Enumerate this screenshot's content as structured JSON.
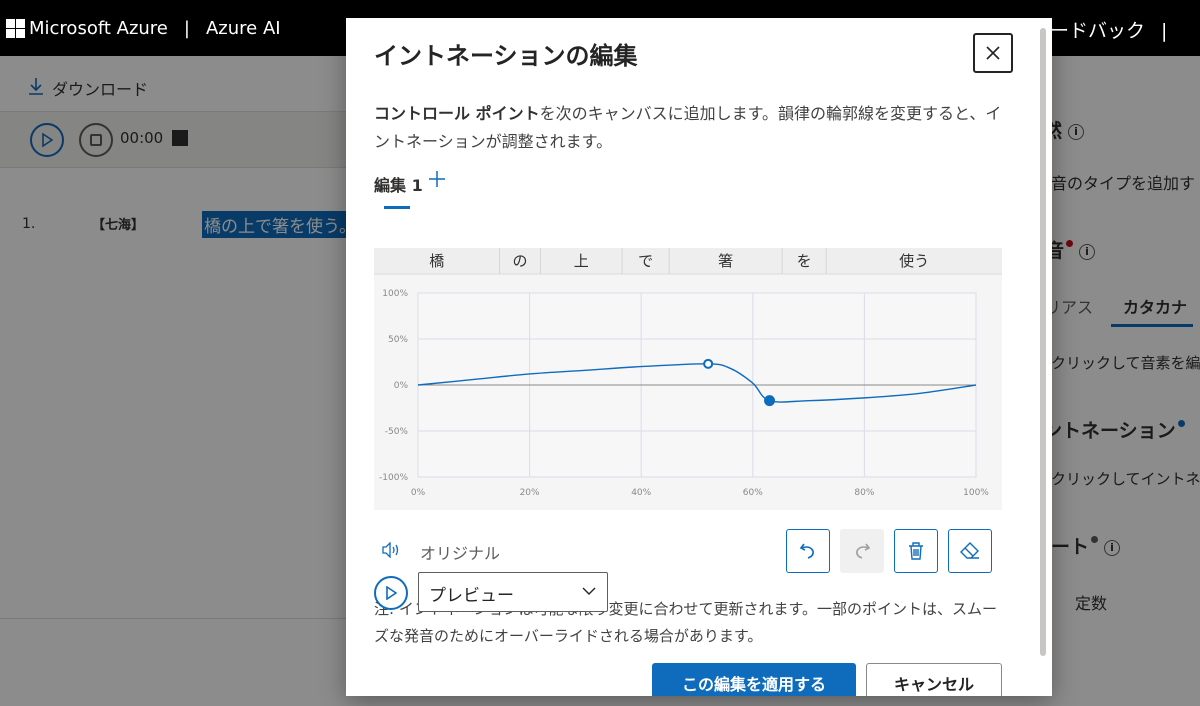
{
  "topbar": {
    "brand": "Microsoft Azure",
    "separator": "|",
    "product": "Azure AI",
    "right_text": "ードバック",
    "right_sep": "|"
  },
  "background": {
    "download_label": "ダウンロード",
    "timecode": "00:00",
    "line_number": "1.",
    "voice_name": "【七海】",
    "sentence": "橋の上で箸を使う。",
    "right_panel": {
      "heading1": "然",
      "text1": "音のタイプを追加す",
      "heading2": "音",
      "tab_alias": "リアス",
      "tab_katakana": "カタカナ",
      "text2": "クリックして音素を編",
      "heading3": "ントネーション",
      "text3": "クリックしてイントネ",
      "heading4": "ート",
      "value4": "定数"
    },
    "colors": {
      "accent": "#0f6cbd",
      "dot_red": "#c50f1f",
      "dot_blue": "#0f6cbd",
      "dot_gray": "#605e5c"
    }
  },
  "dialog": {
    "title": "イントネーションの編集",
    "description_bold": "コントロール ポイント",
    "description_rest": "を次のキャンバスに追加します。韻律の輪郭線を変更すると、イントネーションが調整されます。",
    "tab_label": "編集 1",
    "original_label": "オリジナル",
    "preview_selected": "プレビュー",
    "note": "注: イントネーションは可能な限り変更に合わせて更新されます。一部のポイントは、スムーズな発音のためにオーバーライドされる場合があります。",
    "apply_button": "この編集を適用する",
    "cancel_button": "キャンセル",
    "icons": {
      "close": "close-icon",
      "add": "plus-icon",
      "speaker": "speaker-icon",
      "undo": "undo-icon",
      "redo": "redo-icon",
      "delete": "trash-icon",
      "erase": "eraser-icon",
      "play": "play-icon",
      "chevron": "chevron-down-icon"
    }
  },
  "chart_data": {
    "type": "line",
    "segments": [
      "橋",
      "の",
      "上",
      "で",
      "箸",
      "を",
      "使う"
    ],
    "segment_bounds": [
      0,
      0.2,
      0.265,
      0.395,
      0.47,
      0.65,
      0.72,
      1.0
    ],
    "x_ticks": [
      "0%",
      "20%",
      "40%",
      "60%",
      "80%",
      "100%"
    ],
    "y_ticks": [
      "100%",
      "50%",
      "0%",
      "-50%",
      "-100%"
    ],
    "xlim": [
      0,
      100
    ],
    "ylim": [
      -100,
      100
    ],
    "grid": true,
    "curve": [
      [
        0,
        0
      ],
      [
        10,
        6
      ],
      [
        20,
        12
      ],
      [
        30,
        16
      ],
      [
        40,
        20
      ],
      [
        52,
        23
      ],
      [
        56,
        18
      ],
      [
        60,
        2
      ],
      [
        63,
        -17
      ],
      [
        70,
        -17
      ],
      [
        80,
        -14
      ],
      [
        90,
        -9
      ],
      [
        100,
        0
      ]
    ],
    "control_points": [
      {
        "x": 52,
        "y": 23,
        "style": "hollow"
      },
      {
        "x": 63,
        "y": -17,
        "style": "filled"
      }
    ],
    "line_color": "#0f6cbd"
  }
}
